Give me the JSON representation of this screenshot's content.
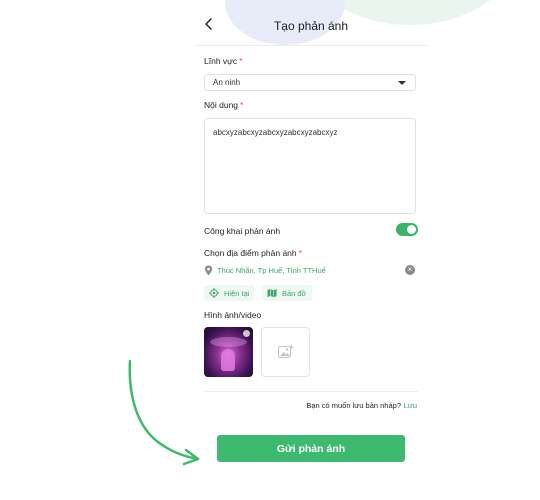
{
  "header": {
    "title": "Tạo phản ánh"
  },
  "form": {
    "field_label": "Lĩnh vực",
    "field_value": "An ninh",
    "content_label": "Nội dung",
    "content_value": "abcxyzabcxyzabcxyzabcxyzabcxyz",
    "public_label": "Công khai phản ánh",
    "public_enabled": true,
    "location_label": "Chọn địa điểm phản ánh",
    "location_value": "Thúc Nhãn, Tp Huế, Tỉnh TTHuế",
    "current_label": "Hiện tại",
    "map_label": "Bản đồ",
    "media_label": "Hình ảnh/video",
    "draft_question": "Bạn có muốn lưu bản nháp?",
    "draft_save": "Lưu",
    "required_mark": "*"
  },
  "submit_label": "Gửi phản ánh",
  "colors": {
    "accent": "#3dba6f",
    "required": "#e04848"
  },
  "icons": [
    "back-arrow-icon",
    "chevron-down-icon",
    "location-pin-icon",
    "clear-icon",
    "gps-target-icon",
    "map-icon",
    "add-image-icon",
    "remove-icon"
  ]
}
